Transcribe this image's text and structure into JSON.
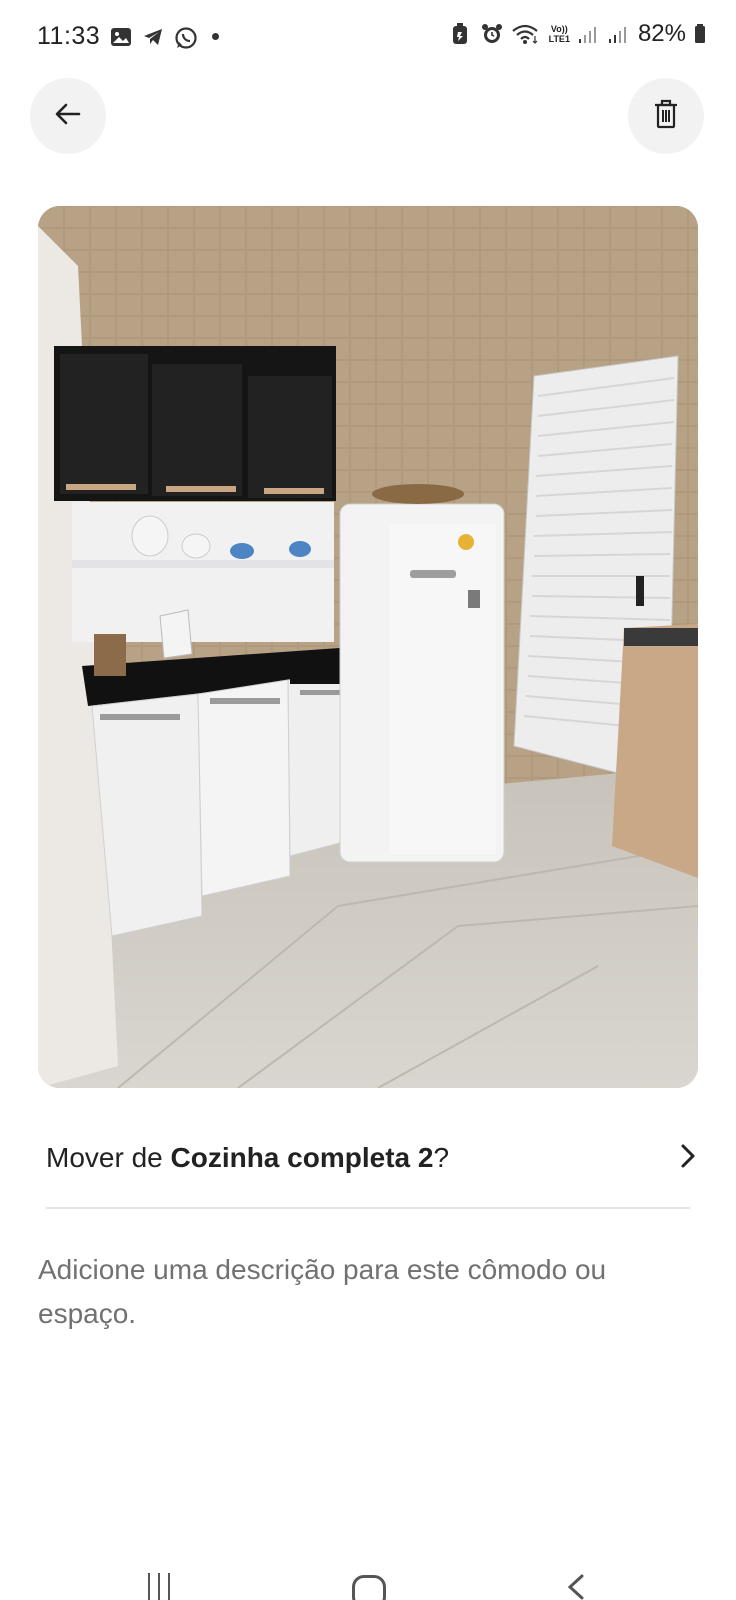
{
  "status_bar": {
    "time": "11:33",
    "battery": "82%",
    "volte_top": "Vo))",
    "volte_bottom": "LTE1"
  },
  "header": {
    "back_icon": "arrow-left-icon",
    "delete_icon": "trash-icon"
  },
  "photo": {
    "subject": "kitchen"
  },
  "move_row": {
    "prefix": "Mover de ",
    "room_name": "Cozinha completa 2",
    "suffix": "?",
    "chevron_icon": "chevron-right-icon"
  },
  "description_placeholder": "Adicione uma descrição para este cômodo ou espaço.",
  "nav": {
    "recent_icon": "recent-apps-icon",
    "home_icon": "home-icon",
    "back_icon": "nav-back-icon"
  }
}
